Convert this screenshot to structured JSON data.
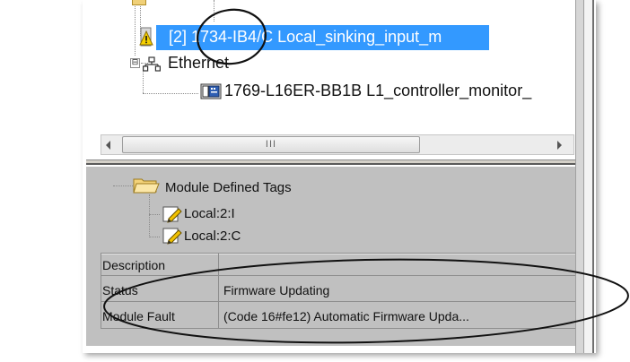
{
  "tree": {
    "selected_module_text": "[2] 1734-IB4/C Local_sinking_input_m",
    "ethernet_label": "Ethernet",
    "controller_text": "1769-L16ER-BB1B L1_controller_monitor_",
    "expander_symbol": "⊟",
    "selection_color": "#3399ff"
  },
  "scrollbar": {
    "thumb_grip": "III"
  },
  "details": {
    "folder_label": "Module Defined Tags",
    "tags": [
      "Local:2:I",
      "Local:2:C"
    ]
  },
  "properties": {
    "rows": [
      {
        "name": "Description",
        "value": ""
      },
      {
        "name": "Status",
        "value": "Firmware Updating"
      },
      {
        "name": "Module Fault",
        "value": "(Code 16#fe12) Automatic Firmware Upda..."
      }
    ]
  },
  "annotations": {
    "icons": [
      "warning-icon",
      "ethernet-network-icon",
      "controller-module-icon",
      "folder-open-icon",
      "tag-pencil-icon"
    ]
  }
}
